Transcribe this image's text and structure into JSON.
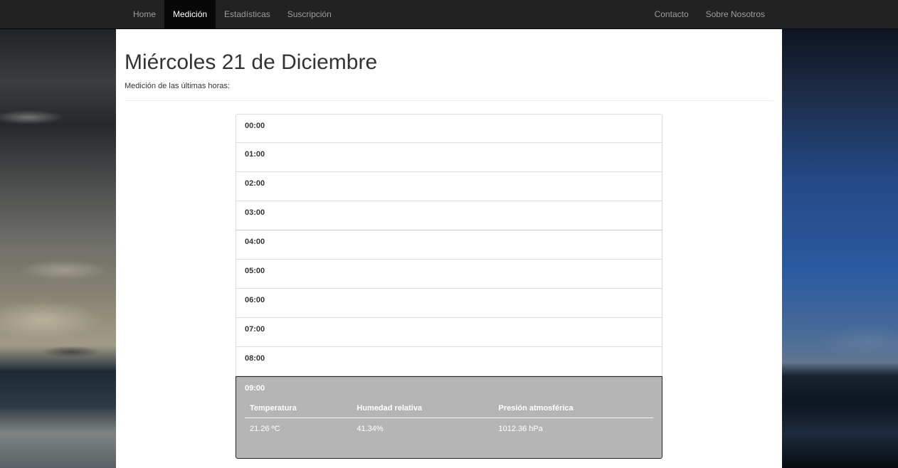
{
  "nav": {
    "left": [
      {
        "label": "Home",
        "active": false
      },
      {
        "label": "Medición",
        "active": true
      },
      {
        "label": "Estadísticas",
        "active": false
      },
      {
        "label": "Suscripción",
        "active": false
      }
    ],
    "right": [
      {
        "label": "Contacto"
      },
      {
        "label": "Sobre Nosotros"
      }
    ]
  },
  "header": {
    "title": "Miércoles 21 de Diciembre",
    "subtitle": "Medición de las últimas horas:"
  },
  "hours": [
    "00:00",
    "01:00",
    "02:00",
    "03:00",
    "04:00",
    "05:00",
    "06:00",
    "07:00",
    "08:00"
  ],
  "active_hour": {
    "label": "09:00",
    "columns": [
      "Temperatura",
      "Humedad relativa",
      "Presión atmosférica"
    ],
    "values": [
      "21.26 ºC",
      "41.34%",
      "1012.36 hPa"
    ]
  },
  "colors": {
    "navbar_bg": "#222222",
    "active_panel_bg": "#b5b5b5"
  }
}
